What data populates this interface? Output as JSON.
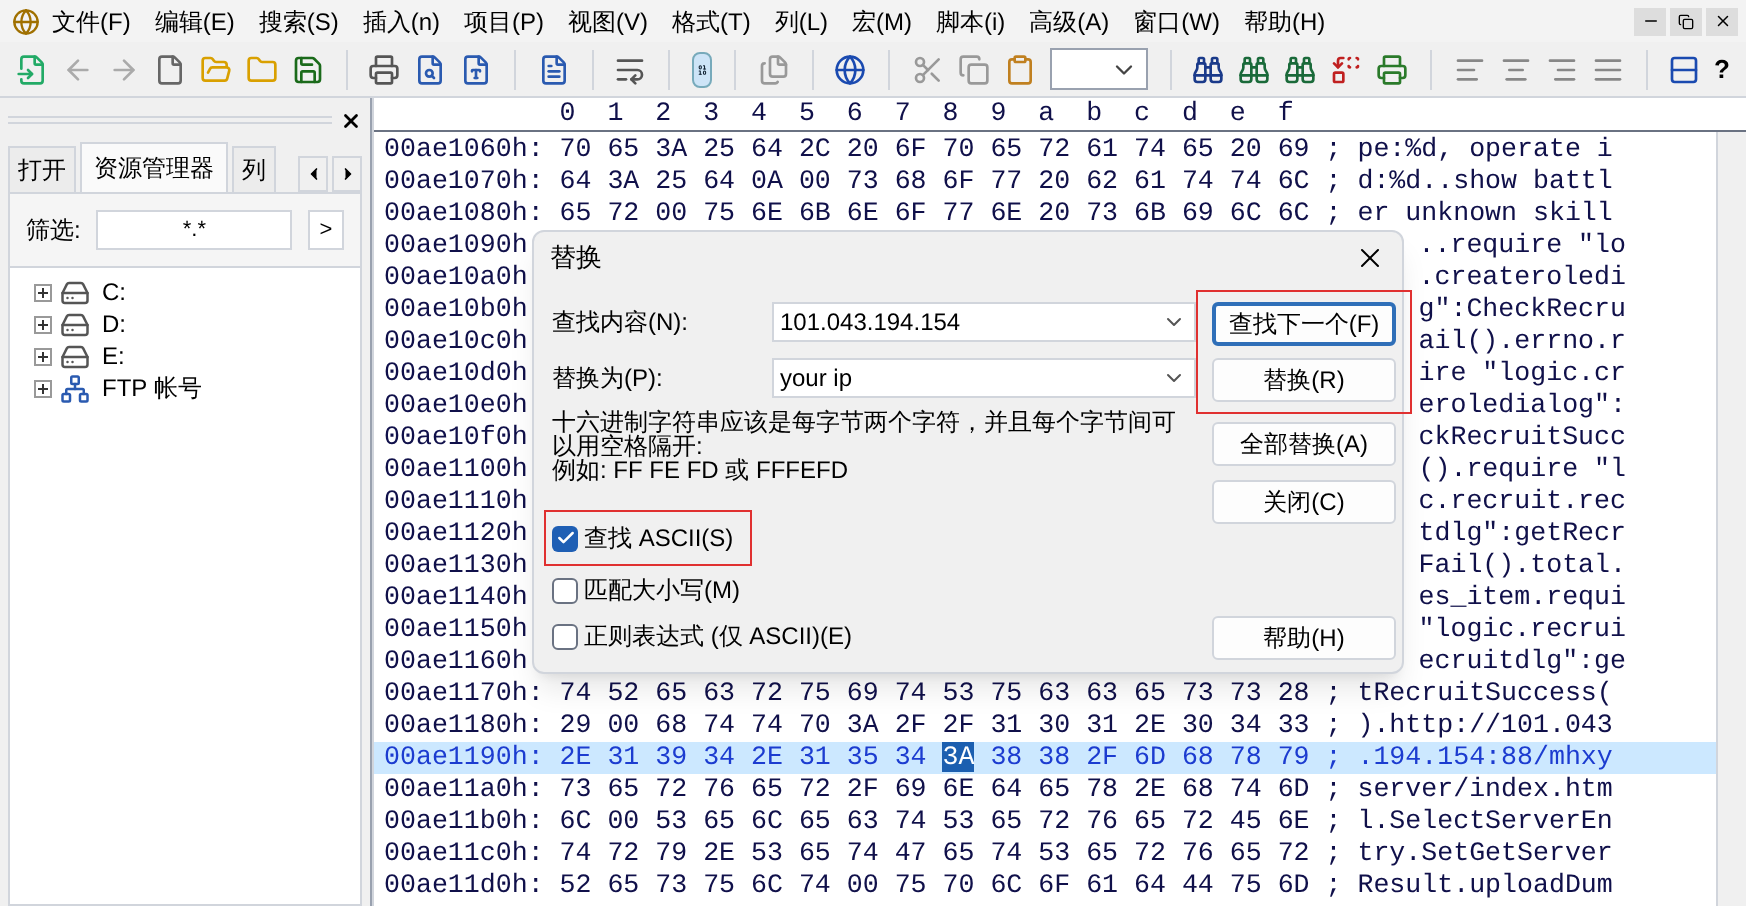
{
  "menu": [
    "文件(F)",
    "编辑(E)",
    "搜索(S)",
    "插入(n)",
    "项目(P)",
    "视图(V)",
    "格式(T)",
    "列(L)",
    "宏(M)",
    "脚本(i)",
    "高级(A)",
    "窗口(W)",
    "帮助(H)"
  ],
  "toolbar": {
    "help": "?"
  },
  "left_panel": {
    "tabs": [
      {
        "label": "打开",
        "selected": false
      },
      {
        "label": "资源管理器",
        "selected": true
      },
      {
        "label": "列",
        "selected": false
      }
    ],
    "filter": {
      "label": "筛选:",
      "value": "*.*",
      "go": ">"
    },
    "tree": [
      {
        "label": "C:",
        "kind": "drive",
        "expanded": false
      },
      {
        "label": "D:",
        "kind": "drive",
        "expanded": false
      },
      {
        "label": "E:",
        "kind": "drive",
        "expanded": false
      },
      {
        "label": "FTP 帐号",
        "kind": "ftp",
        "expanded": false
      }
    ]
  },
  "hex": {
    "columns": [
      "0",
      "1",
      "2",
      "3",
      "4",
      "5",
      "6",
      "7",
      "8",
      "9",
      "a",
      "b",
      "c",
      "d",
      "e",
      "f"
    ],
    "rows": [
      {
        "kind": "full",
        "address": "00ae1060h:",
        "bytes": [
          "70",
          "65",
          "3A",
          "25",
          "64",
          "2C",
          "20",
          "6F",
          "70",
          "65",
          "72",
          "61",
          "74",
          "65",
          "20",
          "69"
        ],
        "sep": ";",
        "ascii": "pe:%d, operate i",
        "selected": false
      },
      {
        "kind": "full",
        "address": "00ae1070h:",
        "bytes": [
          "64",
          "3A",
          "25",
          "64",
          "0A",
          "00",
          "73",
          "68",
          "6F",
          "77",
          "20",
          "62",
          "61",
          "74",
          "74",
          "6C"
        ],
        "sep": ";",
        "ascii": "d:%d..show battl",
        "selected": false
      },
      {
        "kind": "full",
        "address": "00ae1080h:",
        "bytes": [
          "65",
          "72",
          "00",
          "75",
          "6E",
          "6B",
          "6E",
          "6F",
          "77",
          "6E",
          "20",
          "73",
          "6B",
          "69",
          "6C",
          "6C"
        ],
        "sep": ";",
        "ascii": "er unknown skill",
        "selected": false
      },
      {
        "kind": "partial",
        "address": "00ae1090h",
        "ascii": "..require \"lo"
      },
      {
        "kind": "partial",
        "address": "00ae10a0h",
        "ascii": ".createroledi"
      },
      {
        "kind": "partial",
        "address": "00ae10b0h",
        "ascii": "g\":CheckRecru"
      },
      {
        "kind": "partial",
        "address": "00ae10c0h",
        "ascii": "ail().errno.r"
      },
      {
        "kind": "partial",
        "address": "00ae10d0h",
        "ascii": "ire \"logic.cr"
      },
      {
        "kind": "partial",
        "address": "00ae10e0h",
        "ascii": "eroledialog\":"
      },
      {
        "kind": "partial",
        "address": "00ae10f0h",
        "ascii": "ckRecruitSucc"
      },
      {
        "kind": "partial",
        "address": "00ae1100h",
        "ascii": "().require \"l"
      },
      {
        "kind": "partial",
        "address": "00ae1110h",
        "ascii": "c.recruit.rec"
      },
      {
        "kind": "partial",
        "address": "00ae1120h",
        "ascii": "tdlg\":getRecr"
      },
      {
        "kind": "partial",
        "address": "00ae1130h",
        "ascii": "Fail().total."
      },
      {
        "kind": "partial",
        "address": "00ae1140h",
        "ascii": "es_item.requi"
      },
      {
        "kind": "partial",
        "address": "00ae1150h",
        "ascii": "\"logic.recrui"
      },
      {
        "kind": "partial",
        "address": "00ae1160h",
        "ascii": "ecruitdlg\":ge"
      },
      {
        "kind": "full",
        "address": "00ae1170h:",
        "bytes": [
          "74",
          "52",
          "65",
          "63",
          "72",
          "75",
          "69",
          "74",
          "53",
          "75",
          "63",
          "63",
          "65",
          "73",
          "73",
          "28"
        ],
        "sep": ";",
        "ascii": "tRecruitSuccess(",
        "selected": false
      },
      {
        "kind": "full",
        "address": "00ae1180h:",
        "bytes": [
          "29",
          "00",
          "68",
          "74",
          "74",
          "70",
          "3A",
          "2F",
          "2F",
          "31",
          "30",
          "31",
          "2E",
          "30",
          "34",
          "33"
        ],
        "sep": ";",
        "ascii": ").http://101.043",
        "selected": false
      },
      {
        "kind": "full",
        "address": "00ae1190h:",
        "bytes": [
          {
            "v": "2E",
            "selected": false
          },
          {
            "v": "31",
            "selected": false
          },
          {
            "v": "39",
            "selected": false
          },
          {
            "v": "34",
            "selected": false
          },
          {
            "v": "2E",
            "selected": false
          },
          {
            "v": "31",
            "selected": false
          },
          {
            "v": "35",
            "selected": false
          },
          {
            "v": "34",
            "selected": false
          },
          {
            "v": "3A",
            "selected": true
          },
          {
            "v": "38",
            "selected": false
          },
          {
            "v": "38",
            "selected": false
          },
          {
            "v": "2F",
            "selected": false
          },
          {
            "v": "6D",
            "selected": false
          },
          {
            "v": "68",
            "selected": false
          },
          {
            "v": "78",
            "selected": false
          },
          {
            "v": "79",
            "selected": false
          }
        ],
        "sep": ";",
        "ascii": ".194.154:88/mhxy",
        "selected": true
      },
      {
        "kind": "full",
        "address": "00ae11a0h:",
        "bytes": [
          "73",
          "65",
          "72",
          "76",
          "65",
          "72",
          "2F",
          "69",
          "6E",
          "64",
          "65",
          "78",
          "2E",
          "68",
          "74",
          "6D"
        ],
        "sep": ";",
        "ascii": "server/index.htm",
        "selected": false
      },
      {
        "kind": "full",
        "address": "00ae11b0h:",
        "bytes": [
          "6C",
          "00",
          "53",
          "65",
          "6C",
          "65",
          "63",
          "74",
          "53",
          "65",
          "72",
          "76",
          "65",
          "72",
          "45",
          "6E"
        ],
        "sep": ";",
        "ascii": "l.SelectServerEn",
        "selected": false
      },
      {
        "kind": "full",
        "address": "00ae11c0h:",
        "bytes": [
          "74",
          "72",
          "79",
          "2E",
          "53",
          "65",
          "74",
          "47",
          "65",
          "74",
          "53",
          "65",
          "72",
          "76",
          "65",
          "72"
        ],
        "sep": ";",
        "ascii": "try.SetGetServer",
        "selected": false
      },
      {
        "kind": "full",
        "address": "00ae11d0h:",
        "bytes": [
          "52",
          "65",
          "73",
          "75",
          "6C",
          "74",
          "00",
          "75",
          "70",
          "6C",
          "6F",
          "61",
          "64",
          "44",
          "75",
          "6D"
        ],
        "sep": ";",
        "ascii": "Result.uploadDum",
        "selected": false
      }
    ]
  },
  "dialog": {
    "title": "替换",
    "fields": [
      {
        "label": "查找内容(N):",
        "value": "101.043.194.154"
      },
      {
        "label": "替换为(P):",
        "value": "your ip"
      }
    ],
    "hint": "十六进制字符串应该是每字节两个字符，并且每个字节间可以用空格隔开:",
    "example": "例如: FF FE FD 或 FFFEFD",
    "checkboxes": [
      {
        "label": "查找 ASCII(S)",
        "checked": true,
        "highlighted": true
      },
      {
        "label": "匹配大小写(M)",
        "checked": false,
        "highlighted": false
      },
      {
        "label": "正则表达式 (仅 ASCII)(E)",
        "checked": false,
        "highlighted": false
      }
    ],
    "buttons": [
      {
        "label": "查找下一个(F)",
        "kind": "normal",
        "default": true,
        "highlighted": true
      },
      {
        "label": "替换(R)",
        "kind": "normal",
        "default": false,
        "highlighted": true
      },
      {
        "label": "全部替换(A)",
        "kind": "normal",
        "default": false,
        "highlighted": false
      },
      {
        "label": "关闭(C)",
        "kind": "normal",
        "default": false,
        "highlighted": false
      },
      {
        "label": "帮助(H)",
        "kind": "help",
        "default": false,
        "highlighted": false
      }
    ]
  }
}
